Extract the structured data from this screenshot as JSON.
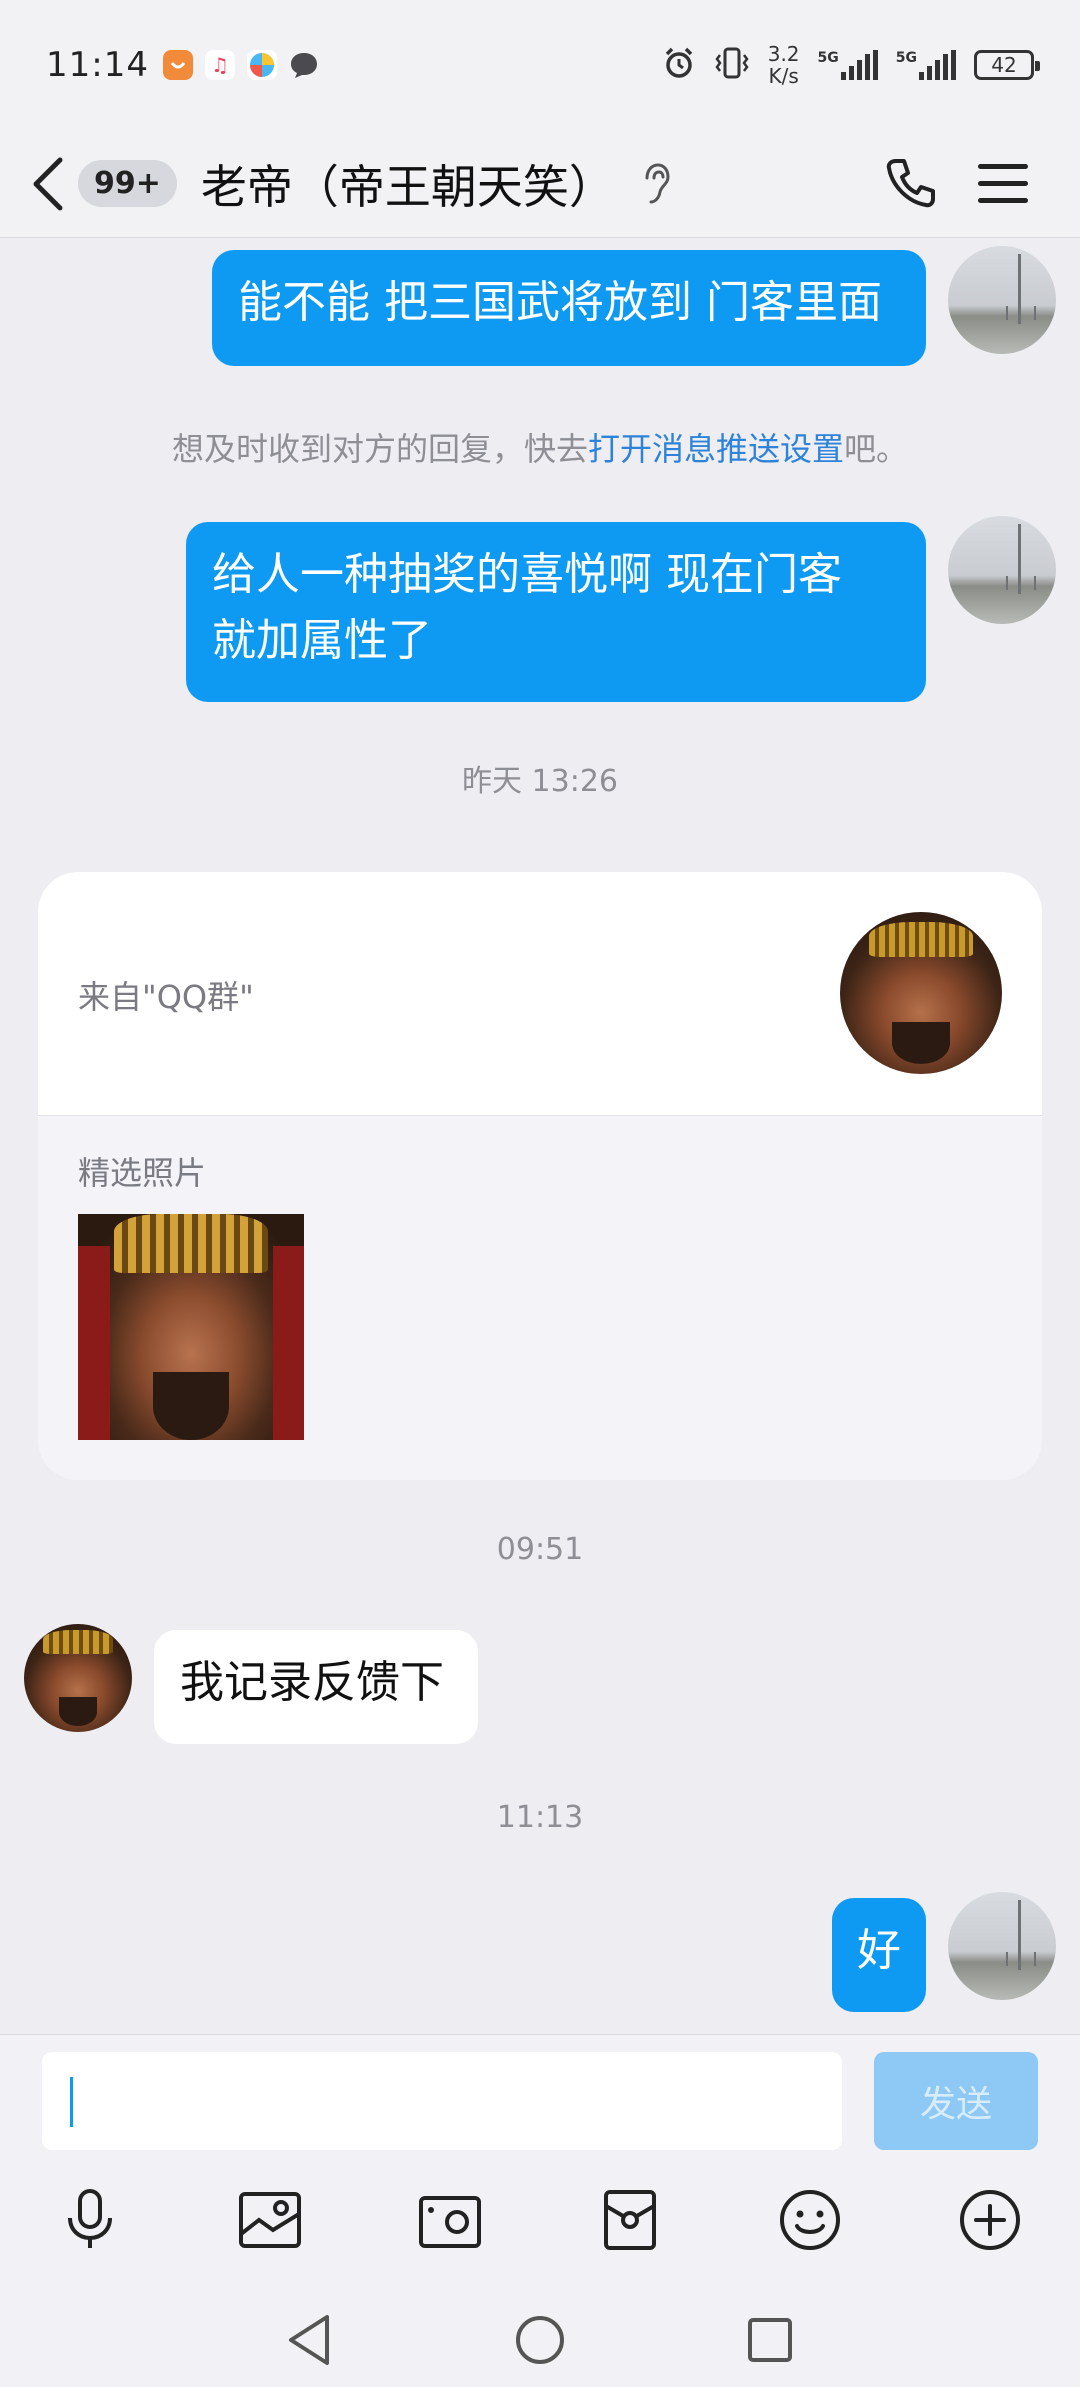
{
  "status_bar": {
    "time": "11:14",
    "network_speed_value": "3.2",
    "network_speed_unit": "K/s",
    "sim1_tag": "5G",
    "sim2_tag": "5G",
    "battery": "42",
    "notification_icons": [
      "app-icon-orange",
      "music-icon",
      "pinwheel-icon",
      "chat-bubble-icon"
    ]
  },
  "header": {
    "unread_badge": "99+",
    "title": "老帝（帝王朝天笑）",
    "icons": [
      "back-icon",
      "ear-icon",
      "phone-icon",
      "menu-icon"
    ]
  },
  "messages": {
    "m1": "能不能 把三国武将放到 门客里面",
    "system_notice_prefix": "想及时收到对方的回复，快去",
    "system_notice_link": "打开消息推送设置",
    "system_notice_suffix": "吧。",
    "m2_line1": "给人一种抽奖的喜悦啊 现在门客",
    "m2_line2": "就加属性了",
    "ts1": "昨天 13:26",
    "card_source": "来自\"QQ群\"",
    "card_section": "精选照片",
    "ts2": "09:51",
    "m3": "我记录反馈下",
    "ts3": "11:13",
    "m4": "好"
  },
  "input": {
    "value": "",
    "send_label": "发送"
  },
  "toolbar": [
    "microphone-icon",
    "image-icon",
    "camera-icon",
    "red-packet-icon",
    "emoji-icon",
    "plus-icon"
  ],
  "nav": [
    "nav-back-icon",
    "nav-home-icon",
    "nav-recents-icon"
  ],
  "colors": {
    "accent": "#0e9af2",
    "link": "#2d83d9",
    "send_disabled": "#8ec9f6",
    "background": "#ededf2"
  }
}
